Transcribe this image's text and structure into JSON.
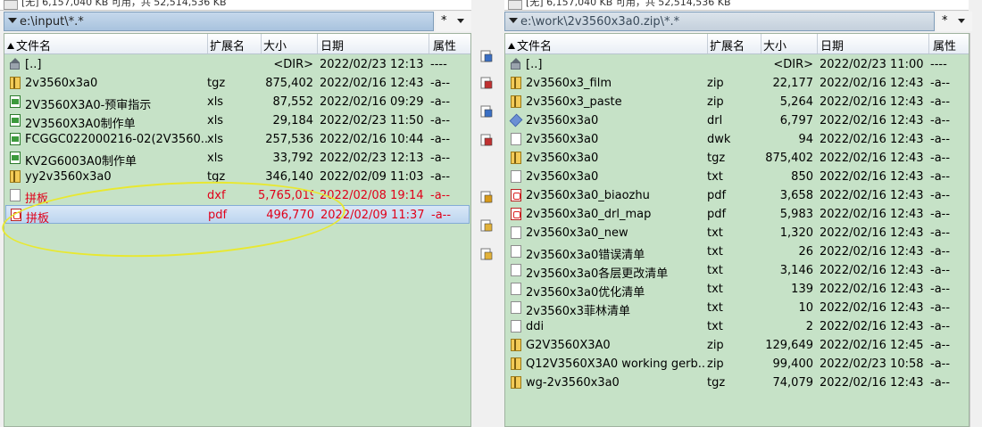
{
  "left": {
    "top_text": "[无] 6,157,040 KB 可用，共 52,514,536 KB",
    "path": "e:\\input\\*.*",
    "path_ctl": {
      "star": "*"
    },
    "headers": {
      "name": "文件名",
      "ext": "扩展名",
      "size": "大小",
      "date": "日期",
      "attr": "属性"
    },
    "rows": [
      {
        "icon": "up",
        "name": "[..]",
        "ext": "",
        "size": "<DIR>",
        "date": "2022/02/23 12:13",
        "attr": "----"
      },
      {
        "icon": "archive",
        "name": "2v3560x3a0",
        "ext": "tgz",
        "size": "875,402",
        "date": "2022/02/16 12:43",
        "attr": "-a--"
      },
      {
        "icon": "xls",
        "name": "2V3560X3A0-预审指示",
        "ext": "xls",
        "size": "87,552",
        "date": "2022/02/16 09:29",
        "attr": "-a--"
      },
      {
        "icon": "xls",
        "name": "2V3560X3A0制作单",
        "ext": "xls",
        "size": "29,184",
        "date": "2022/02/23 11:50",
        "attr": "-a--"
      },
      {
        "icon": "xls",
        "name": "FCGGC022000216-02(2V3560...",
        "ext": "xls",
        "size": "257,536",
        "date": "2022/02/16 10:44",
        "attr": "-a--"
      },
      {
        "icon": "xls",
        "name": "KV2G6003A0制作单",
        "ext": "xls",
        "size": "33,792",
        "date": "2022/02/23 12:13",
        "attr": "-a--"
      },
      {
        "icon": "archive",
        "name": "yy2v3560x3a0",
        "ext": "tgz",
        "size": "346,140",
        "date": "2022/02/09 11:03",
        "attr": "-a--"
      },
      {
        "icon": "doc",
        "name": "拼板",
        "ext": "dxf",
        "size": "5,765,019",
        "date": "2022/02/08 19:14",
        "attr": "-a--",
        "red": true
      },
      {
        "icon": "pdf",
        "name": "拼板",
        "ext": "pdf",
        "size": "496,770",
        "date": "2022/02/09 11:37",
        "attr": "-a--",
        "red": true,
        "selected": true
      }
    ]
  },
  "right": {
    "top_text": "[无] 6,157,040 KB 可用，共 52,514,536 KB",
    "path": "e:\\work\\2v3560x3a0.zip\\*.*",
    "path_ctl": {
      "star": "*"
    },
    "headers": {
      "name": "文件名",
      "ext": "扩展名",
      "size": "大小",
      "date": "日期",
      "attr": "属性"
    },
    "rows": [
      {
        "icon": "up",
        "name": "[..]",
        "ext": "",
        "size": "<DIR>",
        "date": "2022/02/23 11:00",
        "attr": "----"
      },
      {
        "icon": "archive",
        "name": "2v3560x3_film",
        "ext": "zip",
        "size": "22,177",
        "date": "2022/02/16 12:43",
        "attr": "-a--"
      },
      {
        "icon": "archive",
        "name": "2v3560x3_paste",
        "ext": "zip",
        "size": "5,264",
        "date": "2022/02/16 12:43",
        "attr": "-a--"
      },
      {
        "icon": "drl",
        "name": "2v3560x3a0",
        "ext": "drl",
        "size": "6,797",
        "date": "2022/02/16 12:43",
        "attr": "-a--"
      },
      {
        "icon": "doc",
        "name": "2v3560x3a0",
        "ext": "dwk",
        "size": "94",
        "date": "2022/02/16 12:43",
        "attr": "-a--"
      },
      {
        "icon": "archive",
        "name": "2v3560x3a0",
        "ext": "tgz",
        "size": "875,402",
        "date": "2022/02/16 12:43",
        "attr": "-a--"
      },
      {
        "icon": "doc",
        "name": "2v3560x3a0",
        "ext": "txt",
        "size": "850",
        "date": "2022/02/16 12:43",
        "attr": "-a--"
      },
      {
        "icon": "pdf",
        "name": "2v3560x3a0_biaozhu",
        "ext": "pdf",
        "size": "3,658",
        "date": "2022/02/16 12:43",
        "attr": "-a--"
      },
      {
        "icon": "pdf",
        "name": "2v3560x3a0_drl_map",
        "ext": "pdf",
        "size": "5,983",
        "date": "2022/02/16 12:43",
        "attr": "-a--"
      },
      {
        "icon": "doc",
        "name": "2v3560x3a0_new",
        "ext": "txt",
        "size": "1,320",
        "date": "2022/02/16 12:43",
        "attr": "-a--"
      },
      {
        "icon": "doc",
        "name": "2v3560x3a0错误清单",
        "ext": "txt",
        "size": "26",
        "date": "2022/02/16 12:43",
        "attr": "-a--"
      },
      {
        "icon": "doc",
        "name": "2v3560x3a0各层更改清单",
        "ext": "txt",
        "size": "3,146",
        "date": "2022/02/16 12:43",
        "attr": "-a--"
      },
      {
        "icon": "doc",
        "name": "2v3560x3a0优化清单",
        "ext": "txt",
        "size": "139",
        "date": "2022/02/16 12:43",
        "attr": "-a--"
      },
      {
        "icon": "doc",
        "name": "2v3560x3菲林清单",
        "ext": "txt",
        "size": "10",
        "date": "2022/02/16 12:43",
        "attr": "-a--"
      },
      {
        "icon": "doc",
        "name": "ddi",
        "ext": "txt",
        "size": "2",
        "date": "2022/02/16 12:43",
        "attr": "-a--"
      },
      {
        "icon": "archive",
        "name": "G2V3560X3A0",
        "ext": "zip",
        "size": "129,649",
        "date": "2022/02/16 12:45",
        "attr": "-a--"
      },
      {
        "icon": "archive",
        "name": "Q12V3560X3A0 working gerb...",
        "ext": "zip",
        "size": "99,400",
        "date": "2022/02/23 10:58",
        "attr": "-a--"
      },
      {
        "icon": "archive",
        "name": "wg-2v3560x3a0",
        "ext": "tgz",
        "size": "74,079",
        "date": "2022/02/16 12:43",
        "attr": "-a--"
      }
    ]
  },
  "middle_buttons": [
    {
      "name": "find-files-icon",
      "color": "#3a6fc4"
    },
    {
      "name": "delete-file-icon",
      "color": "#c03030"
    },
    {
      "name": "copy-files-icon",
      "color": "#3a6fc4"
    },
    {
      "name": "move-files-icon",
      "color": "#c03030"
    },
    {
      "name": "pack-files-icon",
      "color": "#d89a1a"
    },
    {
      "name": "new-folder-icon",
      "color": "#e2b23a"
    },
    {
      "name": "open-folder-icon",
      "color": "#e2b23a"
    }
  ],
  "colors": {
    "panel_bg": "#c6e2c7",
    "highlight_red": "#e0001a",
    "selection": "#bcd5ef"
  }
}
